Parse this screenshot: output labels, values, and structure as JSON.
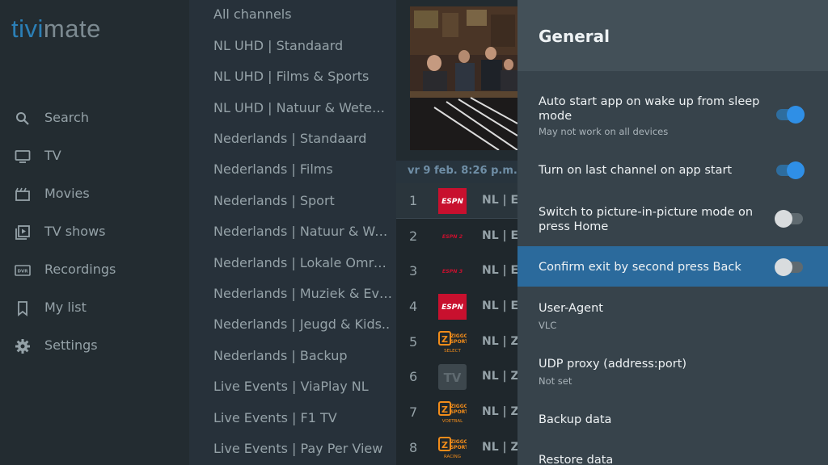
{
  "app": {
    "logo_part1": "tivi",
    "logo_part2": "mate"
  },
  "nav": {
    "items": [
      {
        "label": "Search",
        "icon": "search-icon"
      },
      {
        "label": "TV",
        "icon": "tv-icon"
      },
      {
        "label": "Movies",
        "icon": "movie-icon"
      },
      {
        "label": "TV shows",
        "icon": "tv-shows-icon"
      },
      {
        "label": "Recordings",
        "icon": "dvr-icon"
      },
      {
        "label": "My list",
        "icon": "bookmark-icon"
      },
      {
        "label": "Settings",
        "icon": "gear-icon"
      }
    ]
  },
  "groups": [
    "All channels",
    "NL UHD | Standaard",
    "NL UHD | Films & Sports",
    "NL UHD | Natuur & Wetens..",
    "Nederlands | Standaard",
    "Nederlands | Films",
    "Nederlands | Sport",
    "Nederlands | Natuur & Wete..",
    "Nederlands | Lokale Omroe..",
    "Nederlands | Muziek & Eve..",
    "Nederlands | Jeugd & Kids..",
    "Nederlands | Backup",
    "Live Events | ViaPlay NL",
    "Live Events | F1 TV",
    "Live Events | Pay Per View"
  ],
  "datetime": "vr 9 feb. 8:26 p.m.",
  "channels": [
    {
      "num": "1",
      "logo": "espn",
      "logo_text": "ESPN",
      "name": "NL | ES"
    },
    {
      "num": "2",
      "logo": "espn2",
      "logo_text": "ESPN 2",
      "name": "NL | ES"
    },
    {
      "num": "3",
      "logo": "espn3",
      "logo_text": "ESPN 3",
      "name": "NL | ES"
    },
    {
      "num": "4",
      "logo": "espn",
      "logo_text": "ESPN",
      "name": "NL | ES"
    },
    {
      "num": "5",
      "logo": "ziggo",
      "logo_text": "ZIGGO SPORT",
      "logo_sub": "SELECT",
      "name": "NL | ZI"
    },
    {
      "num": "6",
      "logo": "tv",
      "logo_text": "TV",
      "name": "NL | ZI"
    },
    {
      "num": "7",
      "logo": "ziggo",
      "logo_text": "ZIGGO SPORT",
      "logo_sub": "VOETBAL",
      "name": "NL | ZI"
    },
    {
      "num": "8",
      "logo": "ziggo",
      "logo_text": "ZIGGO SPORT",
      "logo_sub": "RACING",
      "name": "NL | ZI"
    }
  ],
  "settings": {
    "title": "General",
    "items": [
      {
        "title": "Auto start app on wake up from sleep mode",
        "subtitle": "May not work on all devices",
        "toggle": true
      },
      {
        "title": "Turn on last channel on app start",
        "subtitle": "",
        "toggle": true
      },
      {
        "title": "Switch to picture-in-picture mode on press Home",
        "subtitle": "",
        "toggle": false
      },
      {
        "title": "Confirm exit by second press Back",
        "subtitle": "",
        "toggle": false
      },
      {
        "title": "User-Agent",
        "subtitle": "VLC"
      },
      {
        "title": "UDP proxy (address:port)",
        "subtitle": "Not set"
      },
      {
        "title": "Backup data",
        "subtitle": ""
      },
      {
        "title": "Restore data",
        "subtitle": ""
      }
    ]
  },
  "colors": {
    "accent": "#2f8fe6",
    "selected_row": "#2b6a9c",
    "espn_red": "#c8102e",
    "ziggo_orange": "#f28c1a"
  }
}
